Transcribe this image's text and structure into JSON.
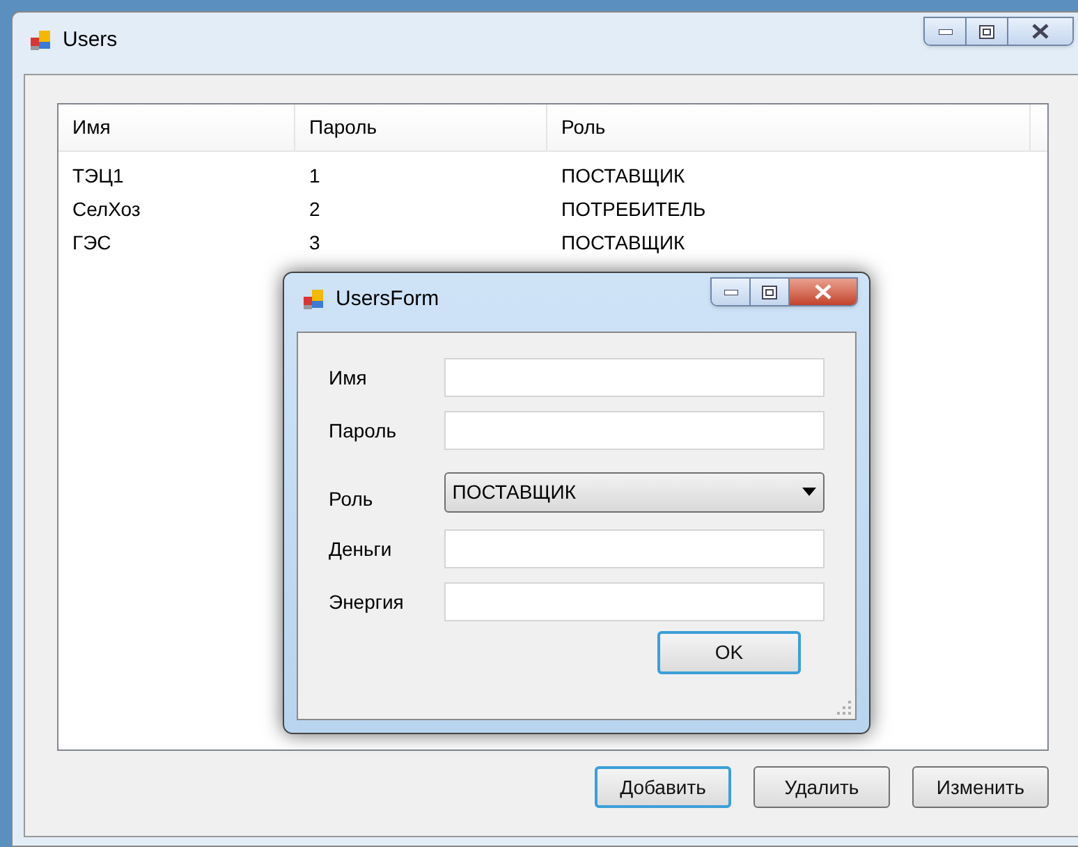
{
  "window": {
    "title": "Users"
  },
  "table": {
    "columns": [
      "Имя",
      "Пароль",
      "Роль"
    ],
    "rows": [
      [
        "ТЭЦ1",
        "1",
        "ПОСТАВЩИК"
      ],
      [
        "СелХоз",
        "2",
        "ПОТРЕБИТЕЛЬ"
      ],
      [
        "ГЭС",
        "3",
        "ПОСТАВЩИК"
      ]
    ]
  },
  "buttons": [
    {
      "label": "Добавить",
      "focused": true
    },
    {
      "label": "Удалить",
      "focused": false
    },
    {
      "label": "Изменить",
      "focused": false
    }
  ],
  "dialog": {
    "title": "UsersForm",
    "fields": [
      {
        "kind": "text",
        "label": "Имя"
      },
      {
        "kind": "text",
        "label": "Пароль"
      },
      {
        "kind": "combo",
        "label": "Роль",
        "value": "ПОСТАВЩИК"
      },
      {
        "kind": "text",
        "label": "Деньги"
      },
      {
        "kind": "text",
        "label": "Энергия"
      }
    ],
    "ok": {
      "label": "OK",
      "focused": true
    }
  }
}
